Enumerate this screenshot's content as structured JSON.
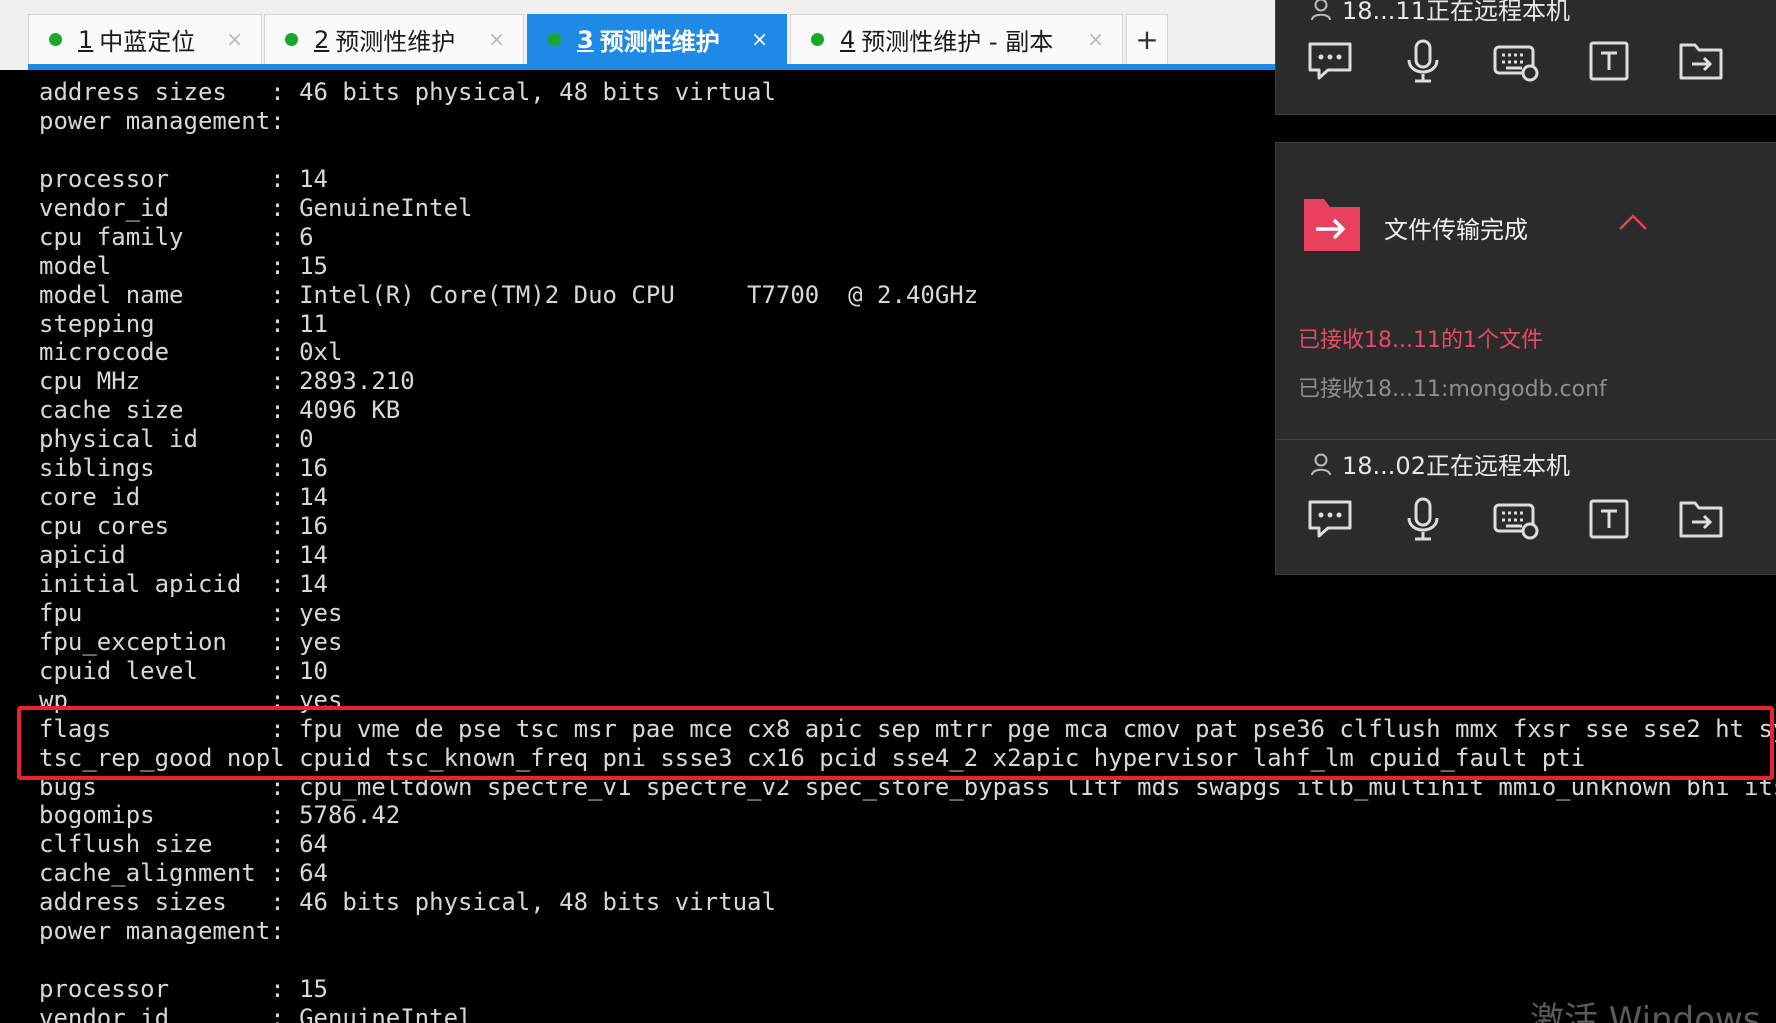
{
  "tabs": [
    {
      "num": "1",
      "label": "中蓝定位",
      "close": "×"
    },
    {
      "num": "2",
      "label": "预测性维护",
      "close": "×"
    },
    {
      "num": "3",
      "label": "预测性维护",
      "close": "×"
    },
    {
      "num": "4",
      "label": "预测性维护 - 副本",
      "close": "×"
    }
  ],
  "tab_add": "+",
  "terminal_lines": [
    "address sizes   : 46 bits physical, 48 bits virtual",
    "power management:",
    "",
    "processor       : 14",
    "vendor_id       : GenuineIntel",
    "cpu family      : 6",
    "model           : 15",
    "model name      : Intel(R) Core(TM)2 Duo CPU     T7700  @ 2.40GHz",
    "stepping        : 11",
    "microcode       : 0xl",
    "cpu MHz         : 2893.210",
    "cache size      : 4096 KB",
    "physical id     : 0",
    "siblings        : 16",
    "core id         : 14",
    "cpu cores       : 16",
    "apicid          : 14",
    "initial apicid  : 14",
    "fpu             : yes",
    "fpu_exception   : yes",
    "cpuid level     : 10",
    "wp              : yes",
    "flags           : fpu vme de pse tsc msr pae mce cx8 apic sep mtrr pge mca cmov pat pse36 clflush mmx fxsr sse sse2 ht syscall n",
    "tsc_rep_good nopl cpuid tsc_known_freq pni ssse3 cx16 pcid sse4_2 x2apic hypervisor lahf_lm cpuid_fault pti",
    "bugs            : cpu_meltdown spectre_v1 spectre_v2 spec_store_bypass l1tf mds swapgs itlb_multihit mmio_unknown bhi its",
    "bogomips        : 5786.42",
    "clflush size    : 64",
    "cache_alignment : 64",
    "address sizes   : 46 bits physical, 48 bits virtual",
    "power management:",
    "",
    "processor       : 15",
    "vendor_id       : GenuineIntel"
  ],
  "remote_panel": {
    "top_user_text": "18...11正在远程本机",
    "transfer_title": "文件传输完成",
    "received_summary": "已接收18...11的1个文件",
    "received_file": "已接收18...11:mongodb.conf",
    "second_user_text": "18...02正在远程本机"
  },
  "icons": [
    "chat-icon",
    "microphone-icon",
    "keyboard-icon",
    "text-icon",
    "file-transfer-icon"
  ],
  "watermark": "激活 Windows",
  "colors": {
    "tab_accent": "#1e8ae6",
    "tab_dot": "#19a82a",
    "highlight_box": "#e8232e",
    "folder_icon": "#e8405e",
    "received_text": "#e84a6a"
  }
}
